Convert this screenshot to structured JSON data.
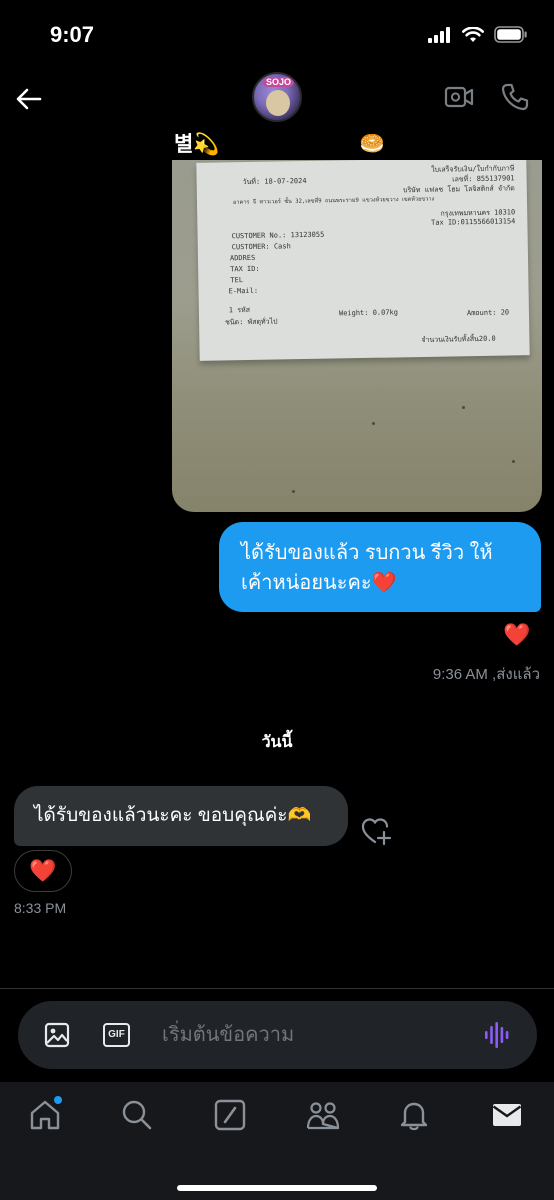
{
  "status_bar": {
    "time": "9:07"
  },
  "header": {
    "contact_name": "별💫",
    "contact_name_suffix_emoji": "🥯",
    "avatar_badge": "SOJO"
  },
  "receipt": {
    "date": "วันที่: 18-07-2024",
    "address_line": "อาคาร จี ทาวเวอร์ ชั้น 32,เลขที่9 ถนนพระราม9 แขวงห้วยขวาง เขตห้วยขวาง",
    "company_lines": [
      "ใบเสร็จรับเงิน/ใบกำกับภาษี",
      "เลขที่: 855137901",
      "บริษัท แฟลช โฮม โลจิสติกส์ จำกัด",
      "กรุงเทพมหานคร 10310",
      "Tax ID:0115566013154"
    ],
    "customer_no": "CUSTOMER No.: 13123055",
    "customer": "CUSTOMER: Cash",
    "address": "ADDRES",
    "tax_id": "TAX ID:",
    "tel": "TEL",
    "email": "E-Mail:",
    "item_row": "1 รหัส",
    "item_name": "ชนิด: พัสดุทั่วไป",
    "weight": "Weight: 0.07kg",
    "amount": "Amount: 20",
    "total": "จำนวนเงินรับทั้งสิ้น20.0"
  },
  "messages": {
    "outgoing_text": "ได้รับของแล้ว รบกวน รีวิว ให้เค้าหน่อยนะคะ❤️",
    "outgoing_reaction": "❤️",
    "outgoing_meta": "9:36 AM ,ส่งแล้ว",
    "day_separator": "วันนี้",
    "incoming_text": "ได้รับของแล้วนะคะ ขอบคุณค่ะ🫶",
    "incoming_reaction": "❤️",
    "incoming_time": "8:33 PM"
  },
  "composer": {
    "gif_label": "GIF",
    "placeholder": "เริ่มต้นข้อความ"
  },
  "colors": {
    "accent": "#1d9bf0",
    "incoming_bubble": "#2f3336",
    "voice_icon": "#8b5cf6",
    "heart": "#e3203c"
  }
}
